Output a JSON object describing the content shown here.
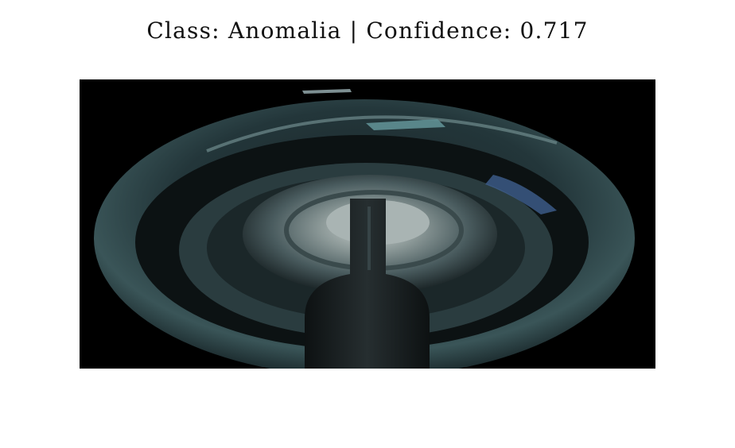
{
  "figure": {
    "title": "Class: Anomalia | Confidence: 0.717",
    "class_label": "Anomalia",
    "confidence": 0.717
  },
  "image": {
    "subject": "insulator-disc-photo",
    "background_color": "#000000",
    "accent_colors": {
      "rim": "#3a5558",
      "inner_ring": "#6e7d7f",
      "highlight": "#a9bcbd",
      "stem": "#151a1c",
      "blue_patch": "#3f5f8f"
    }
  }
}
